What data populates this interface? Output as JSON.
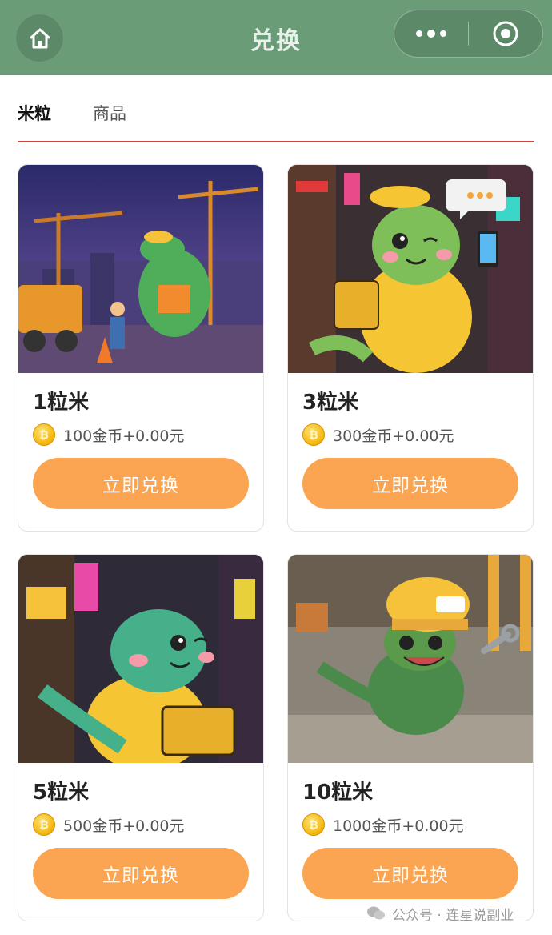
{
  "header": {
    "title": "兑换",
    "bg_color": "#6a9c78"
  },
  "tabs": [
    {
      "label": "米粒",
      "active": true
    },
    {
      "label": "商品",
      "active": false
    }
  ],
  "accent": "#d0423a",
  "button_color": "#fba452",
  "cards": [
    {
      "name": "1粒米",
      "price": "100金币+0.00元",
      "button": "立即兑换",
      "image": "dinosaur-construction-worker-image"
    },
    {
      "name": "3粒米",
      "price": "300金币+0.00元",
      "button": "立即兑换",
      "image": "dinosaur-delivery-phone-image"
    },
    {
      "name": "5粒米",
      "price": "500金币+0.00元",
      "button": "立即兑换",
      "image": "dinosaur-delivery-box-image"
    },
    {
      "name": "10粒米",
      "price": "1000金币+0.00元",
      "button": "立即兑换",
      "image": "dinosaur-wrench-image"
    }
  ],
  "watermark": "公众号 · 连星说副业"
}
